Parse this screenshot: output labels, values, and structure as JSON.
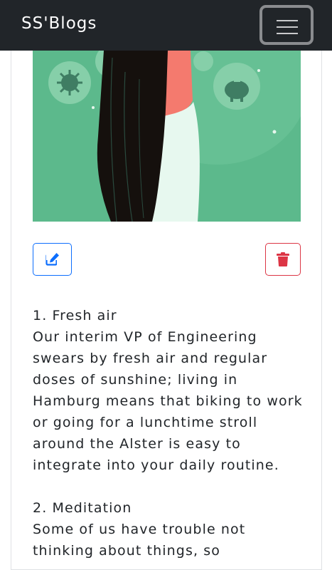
{
  "navbar": {
    "brand": "SS'Blogs",
    "toggler_icon": "hamburger-menu-icon"
  },
  "post": {
    "image_alt": "Illustration of a woman with long black hair in profile against a green background with floating bubbles",
    "actions": {
      "edit_icon": "edit-icon",
      "edit_color": "#0d6efd",
      "delete_icon": "trash-icon",
      "delete_color": "#dc3545"
    },
    "sections": [
      {
        "heading": "1. Fresh air",
        "body": "Our interim VP of Engineering swears by fresh air and regular doses of sunshine; living in Hamburg means that biking to work or going for a lunchtime stroll around the Alster is easy to integrate into your daily routine."
      },
      {
        "heading": "2. Meditation",
        "body": "Some of us have trouble not thinking about things, so"
      }
    ]
  },
  "colors": {
    "navbar_bg": "#212529",
    "hero_green": "#5cb98c"
  }
}
